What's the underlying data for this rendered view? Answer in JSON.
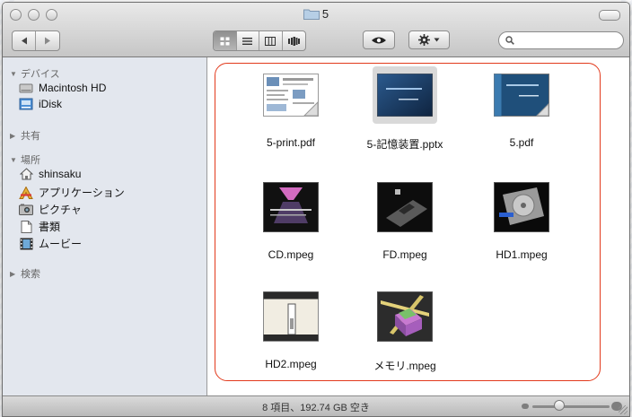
{
  "window": {
    "title": "5"
  },
  "toolbar": {
    "view_modes": [
      "icon-view",
      "list-view",
      "column-view",
      "coverflow-view"
    ],
    "active_view": "icon-view",
    "search": {
      "value": "",
      "placeholder": ""
    }
  },
  "sidebar": {
    "devices_header": "デバイス",
    "devices": [
      {
        "label": "Macintosh HD",
        "icon": "hard-drive-icon"
      },
      {
        "label": "iDisk",
        "icon": "idisk-icon"
      }
    ],
    "shared_header": "共有",
    "places_header": "場所",
    "places": [
      {
        "label": "shinsaku",
        "icon": "home-icon"
      },
      {
        "label": "アプリケーション",
        "icon": "applications-icon"
      },
      {
        "label": "ピクチャ",
        "icon": "pictures-icon"
      },
      {
        "label": "書類",
        "icon": "documents-icon"
      },
      {
        "label": "ムービー",
        "icon": "movies-icon"
      }
    ],
    "search_header": "検索"
  },
  "files": [
    {
      "name": "5-print.pdf",
      "icon": "pdf-thumbnail-icon"
    },
    {
      "name": "5-記憶装置.pptx",
      "icon": "pptx-thumbnail-icon",
      "selected": true
    },
    {
      "name": "5.pdf",
      "icon": "pdf-thumbnail-icon"
    },
    {
      "name": "CD.mpeg",
      "icon": "video-thumbnail-icon"
    },
    {
      "name": "FD.mpeg",
      "icon": "video-thumbnail-icon"
    },
    {
      "name": "HD1.mpeg",
      "icon": "video-thumbnail-icon"
    },
    {
      "name": "HD2.mpeg",
      "icon": "video-thumbnail-icon"
    },
    {
      "name": "メモリ.mpeg",
      "icon": "video-thumbnail-icon"
    }
  ],
  "status": {
    "text": "8 項目、192.74 GB 空き",
    "icon_size_fraction": 0.35
  },
  "colors": {
    "selection_ring": "#e23a1c",
    "sidebar_bg": "#e3e7ee"
  }
}
